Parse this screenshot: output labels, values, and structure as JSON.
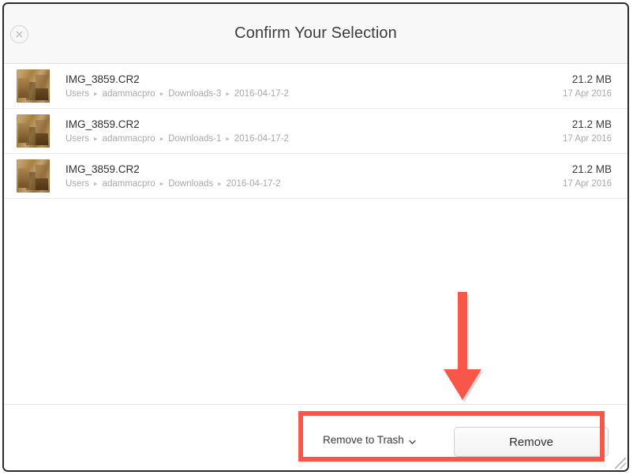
{
  "window": {
    "title": "Confirm Your Selection",
    "close_icon": "close-circle-icon",
    "resize_grip": "resize-grip-icon"
  },
  "file_list": {
    "rows": [
      {
        "name": "IMG_3859.CR2",
        "path": [
          "Users",
          "adammacpro",
          "Downloads-3",
          "2016-04-17-2"
        ],
        "size": "21.2 MB",
        "date": "17 Apr 2016",
        "thumbnail": "photo-thumbnail"
      },
      {
        "name": "IMG_3859.CR2",
        "path": [
          "Users",
          "adammacpro",
          "Downloads-1",
          "2016-04-17-2"
        ],
        "size": "21.2 MB",
        "date": "17 Apr 2016",
        "thumbnail": "photo-thumbnail"
      },
      {
        "name": "IMG_3859.CR2",
        "path": [
          "Users",
          "adammacpro",
          "Downloads",
          "2016-04-17-2"
        ],
        "size": "21.2 MB",
        "date": "17 Apr 2016",
        "thumbnail": "photo-thumbnail"
      }
    ],
    "path_separator": "▸"
  },
  "bottom_bar": {
    "action_select_label": "Remove to Trash",
    "action_select_icon": "chevron-down-icon",
    "remove_button_label": "Remove"
  },
  "annotations": {
    "highlight_color": "#f9564a",
    "arrow_icon": "down-arrow-annotation",
    "box_icon": "highlight-box-annotation"
  }
}
